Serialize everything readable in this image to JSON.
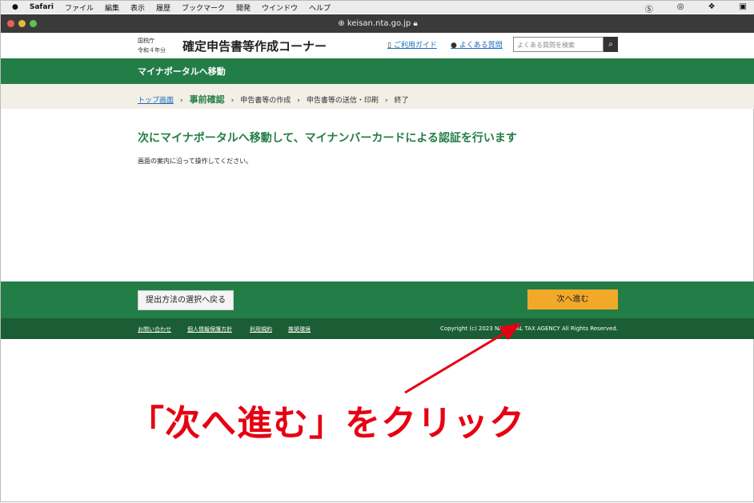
{
  "menubar": {
    "app": "Safari",
    "items": [
      "ファイル",
      "編集",
      "表示",
      "履歴",
      "ブックマーク",
      "開発",
      "ウインドウ",
      "ヘルプ"
    ]
  },
  "browser": {
    "url": "keisan.nta.go.jp"
  },
  "header": {
    "agency": "国税庁",
    "year": "令和４年分",
    "title": "確定申告書等作成コーナー",
    "guide": "ご利用ガイド",
    "faq": "よくある質問",
    "search_placeholder": "よくある質問を検索"
  },
  "page_bar": {
    "title": "マイナポータルへ移動"
  },
  "breadcrumb": [
    "トップ画面",
    "事前確認",
    "申告書等の作成",
    "申告書等の送信・印刷",
    "終了"
  ],
  "main": {
    "heading": "次にマイナポータルへ移動して、マイナンバーカードによる認証を行います",
    "lead": "画面の案内に沿って操作してください。"
  },
  "footer": {
    "back": "提出方法の選択へ戻る",
    "next": "次へ進む",
    "links": [
      "お問い合わせ",
      "個人情報保護方針",
      "利用規約",
      "推奨環境"
    ],
    "copyright": "Copyright (c) 2023 NATIONAL TAX AGENCY All Rights Reserved."
  },
  "annotation": {
    "text": "「次へ進む」をクリック",
    "color": "#e60012"
  }
}
